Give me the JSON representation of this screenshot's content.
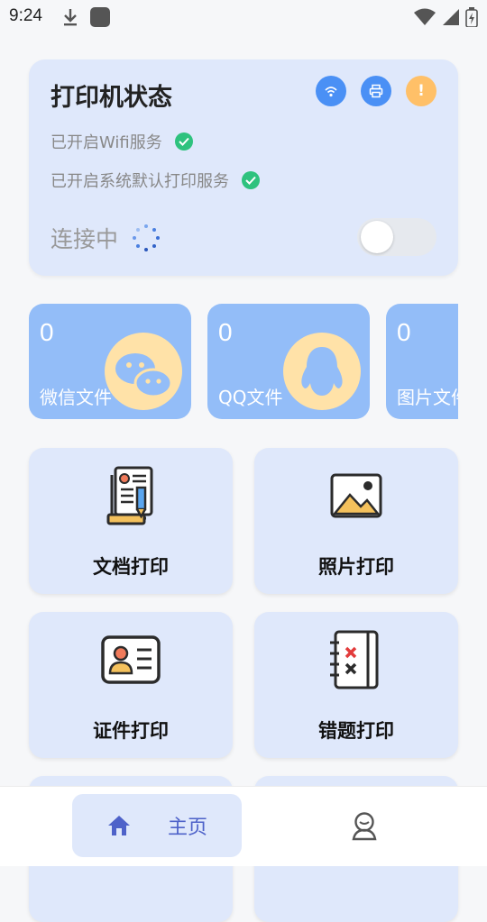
{
  "status_bar": {
    "time": "9:24"
  },
  "printer_status": {
    "title": "打印机状态",
    "wifi_service": "已开启Wifi服务",
    "print_service": "已开启系统默认打印服务",
    "connection": "连接中",
    "alert_icon_text": "!",
    "toggle_on": false
  },
  "sources": [
    {
      "count": "0",
      "label": "微信文件",
      "icon": "wechat-icon"
    },
    {
      "count": "0",
      "label": "QQ文件",
      "icon": "qq-icon"
    },
    {
      "count": "0",
      "label": "图片文件",
      "icon": "image-icon"
    }
  ],
  "features": [
    {
      "label": "文档打印",
      "icon": "document-icon"
    },
    {
      "label": "照片打印",
      "icon": "photo-icon"
    },
    {
      "label": "证件打印",
      "icon": "id-card-icon"
    },
    {
      "label": "错题打印",
      "icon": "wrong-question-icon"
    }
  ],
  "nav": {
    "home_label": "主页"
  },
  "colors": {
    "card_bg": "#dfe8fb",
    "accent_blue": "#4a90f5",
    "source_blue": "#93bdf8",
    "check_green": "#2ec27e",
    "nav_text": "#4e62c9"
  }
}
